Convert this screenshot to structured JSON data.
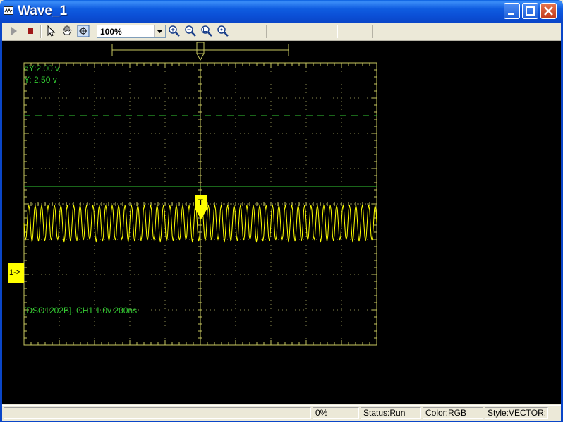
{
  "window": {
    "title": "Wave_1",
    "icon": "waveform-app-icon"
  },
  "toolbar": {
    "zoom_value": "100%",
    "tools": [
      "play-icon",
      "stop-icon",
      "pointer-icon",
      "hand-pan-icon",
      "fit-view-icon",
      "zoom-in-icon",
      "zoom-out-icon",
      "zoom-region-icon",
      "zoom-reset-icon"
    ]
  },
  "scope": {
    "dy_readout": "dY:2.00 v",
    "y_readout": "Y:  2.50 v",
    "info": "[DSO1202B]. CH1 1.0v 200ns",
    "channel_marker": "1->",
    "trigger_marker": "T",
    "trace_color": "#ffff00",
    "grid_color": "#c8c860",
    "cursor_color": "#33cc33"
  },
  "statusbar": {
    "progress": "0%",
    "status": "Status:Run",
    "color": "Color:RGB",
    "style": "Style:VECTOR:"
  }
}
